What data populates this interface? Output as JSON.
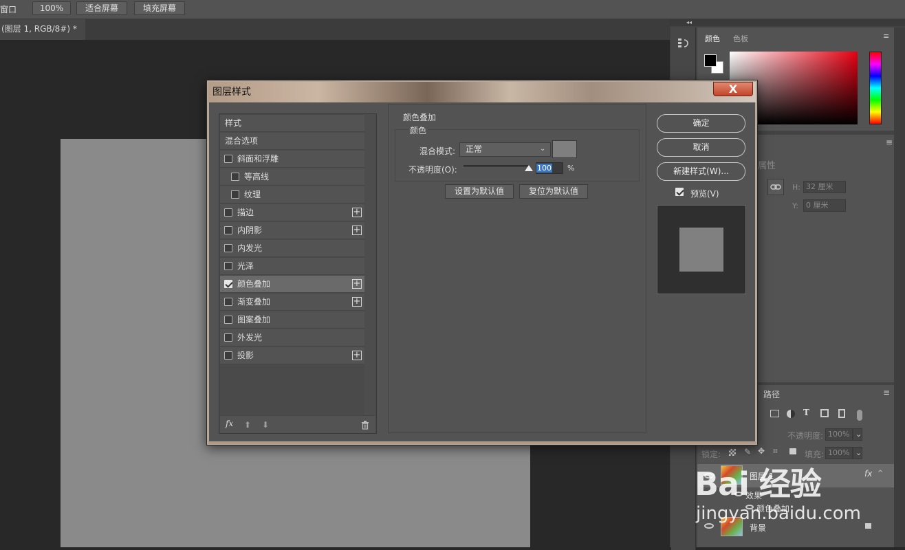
{
  "optionsbar": {
    "window_label": "窗口",
    "zoom": "100%",
    "fit_screen": "适合屏幕",
    "fill_screen": "填充屏幕"
  },
  "document": {
    "tab_title": "(图层 1, RGB/8#) *",
    "tab_close": "×"
  },
  "right_panels": {
    "collapse": "◂◂",
    "color_tab": "颜色",
    "swatches_tab": "色板",
    "props_title": "属性",
    "h_label": "H:",
    "h_value": "32 厘米",
    "y_label": "Y:",
    "y_value": "0 厘米",
    "paths_tab": "路径",
    "opacity_label": "不透明度:",
    "opacity_value": "100%",
    "lock_label": "锁定:",
    "fill_label": "填充:",
    "fill_value": "100%",
    "layers": [
      {
        "name": "图层 1",
        "fx": "fx"
      },
      {
        "name": "效果"
      },
      {
        "name": "颜色叠加"
      },
      {
        "name": "背景"
      }
    ]
  },
  "dialog": {
    "title": "图层样式",
    "close": "X",
    "styles": [
      {
        "label": "样式",
        "checkbox": false,
        "checked": false,
        "plus": false,
        "indent": false
      },
      {
        "label": "混合选项",
        "checkbox": false,
        "checked": false,
        "plus": false,
        "indent": false
      },
      {
        "label": "斜面和浮雕",
        "checkbox": true,
        "checked": false,
        "plus": false,
        "indent": false
      },
      {
        "label": "等高线",
        "checkbox": true,
        "checked": false,
        "plus": false,
        "indent": true
      },
      {
        "label": "纹理",
        "checkbox": true,
        "checked": false,
        "plus": false,
        "indent": true
      },
      {
        "label": "描边",
        "checkbox": true,
        "checked": false,
        "plus": true,
        "indent": false
      },
      {
        "label": "内阴影",
        "checkbox": true,
        "checked": false,
        "plus": true,
        "indent": false
      },
      {
        "label": "内发光",
        "checkbox": true,
        "checked": false,
        "plus": false,
        "indent": false
      },
      {
        "label": "光泽",
        "checkbox": true,
        "checked": false,
        "plus": false,
        "indent": false
      },
      {
        "label": "颜色叠加",
        "checkbox": true,
        "checked": true,
        "plus": true,
        "indent": false,
        "selected": true
      },
      {
        "label": "渐变叠加",
        "checkbox": true,
        "checked": false,
        "plus": true,
        "indent": false
      },
      {
        "label": "图案叠加",
        "checkbox": true,
        "checked": false,
        "plus": false,
        "indent": false
      },
      {
        "label": "外发光",
        "checkbox": true,
        "checked": false,
        "plus": false,
        "indent": false
      },
      {
        "label": "投影",
        "checkbox": true,
        "checked": false,
        "plus": true,
        "indent": false
      }
    ],
    "fx_label": "fx",
    "section_title": "颜色叠加",
    "group_title": "颜色",
    "blend_label": "混合模式:",
    "blend_value": "正常",
    "opacity_label": "不透明度(O):",
    "opacity_value": "100",
    "opacity_unit": "%",
    "opacity_level": 1.0,
    "overlay_color": "#7f7f7f",
    "set_default": "设置为默认值",
    "reset_default": "复位为默认值",
    "ok": "确定",
    "cancel": "取消",
    "new_style": "新建样式(W)...",
    "preview_label": "预览(V)",
    "preview_checked": true
  },
  "watermark": {
    "line1": "Bai 经验",
    "line2": "jingyan.baidu.com"
  }
}
